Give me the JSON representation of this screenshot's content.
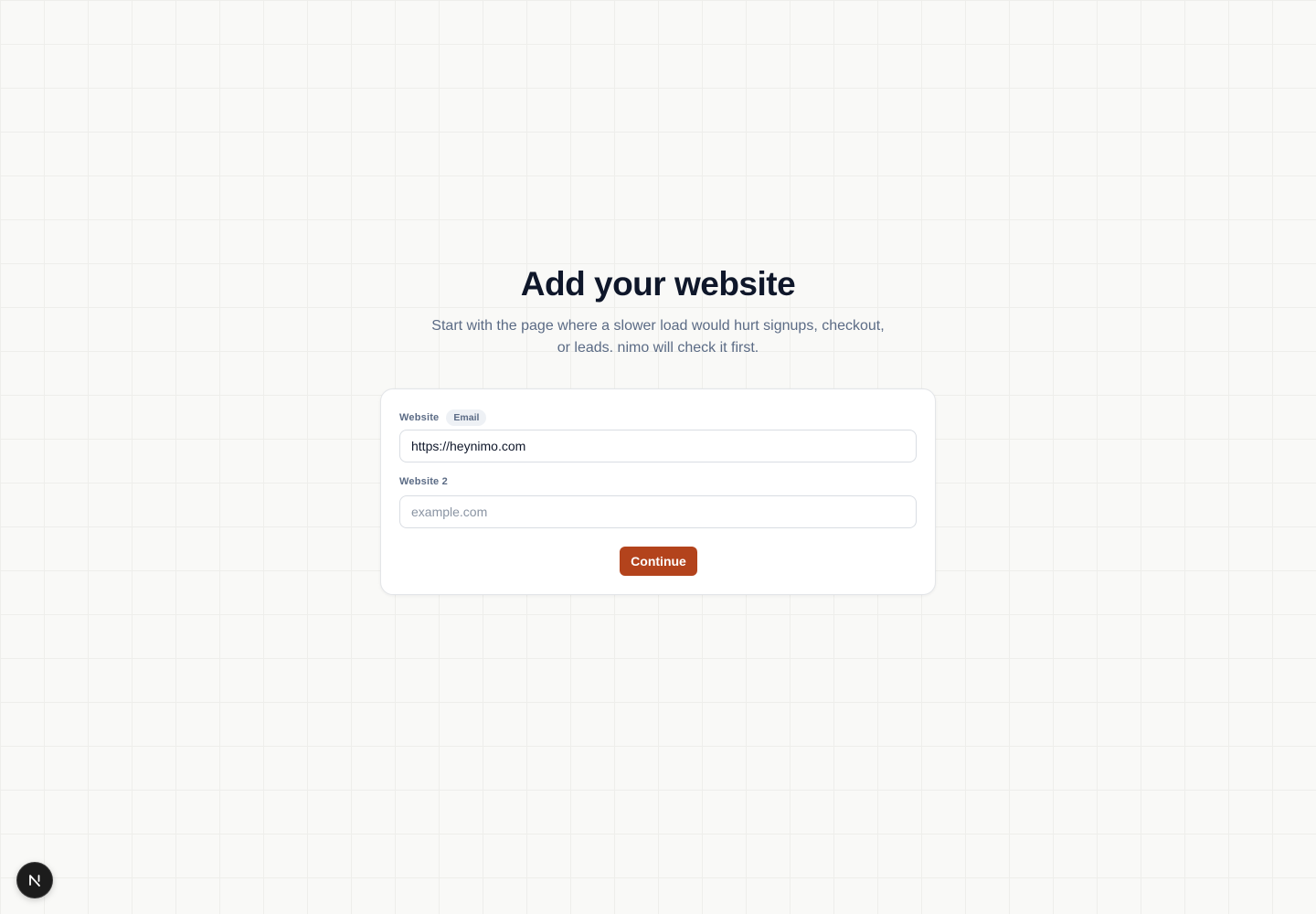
{
  "header": {
    "title": "Add your website",
    "subtitle": "Start with the page where a slower load would hurt signups, checkout, or leads. nimo will check it first."
  },
  "form": {
    "field1": {
      "label": "Website",
      "toggle_label": "Email",
      "value": "https://heynimo.com"
    },
    "field2": {
      "label": "Website 2",
      "value": "",
      "placeholder": "example.com"
    },
    "submit_label": "Continue"
  },
  "dev_badge": {
    "icon": "nextjs-n-icon",
    "glyph": "N"
  },
  "colors": {
    "accent": "#b3431c",
    "background": "#f9f9f7",
    "title": "#0f172a",
    "muted_text": "#5b6b85"
  }
}
